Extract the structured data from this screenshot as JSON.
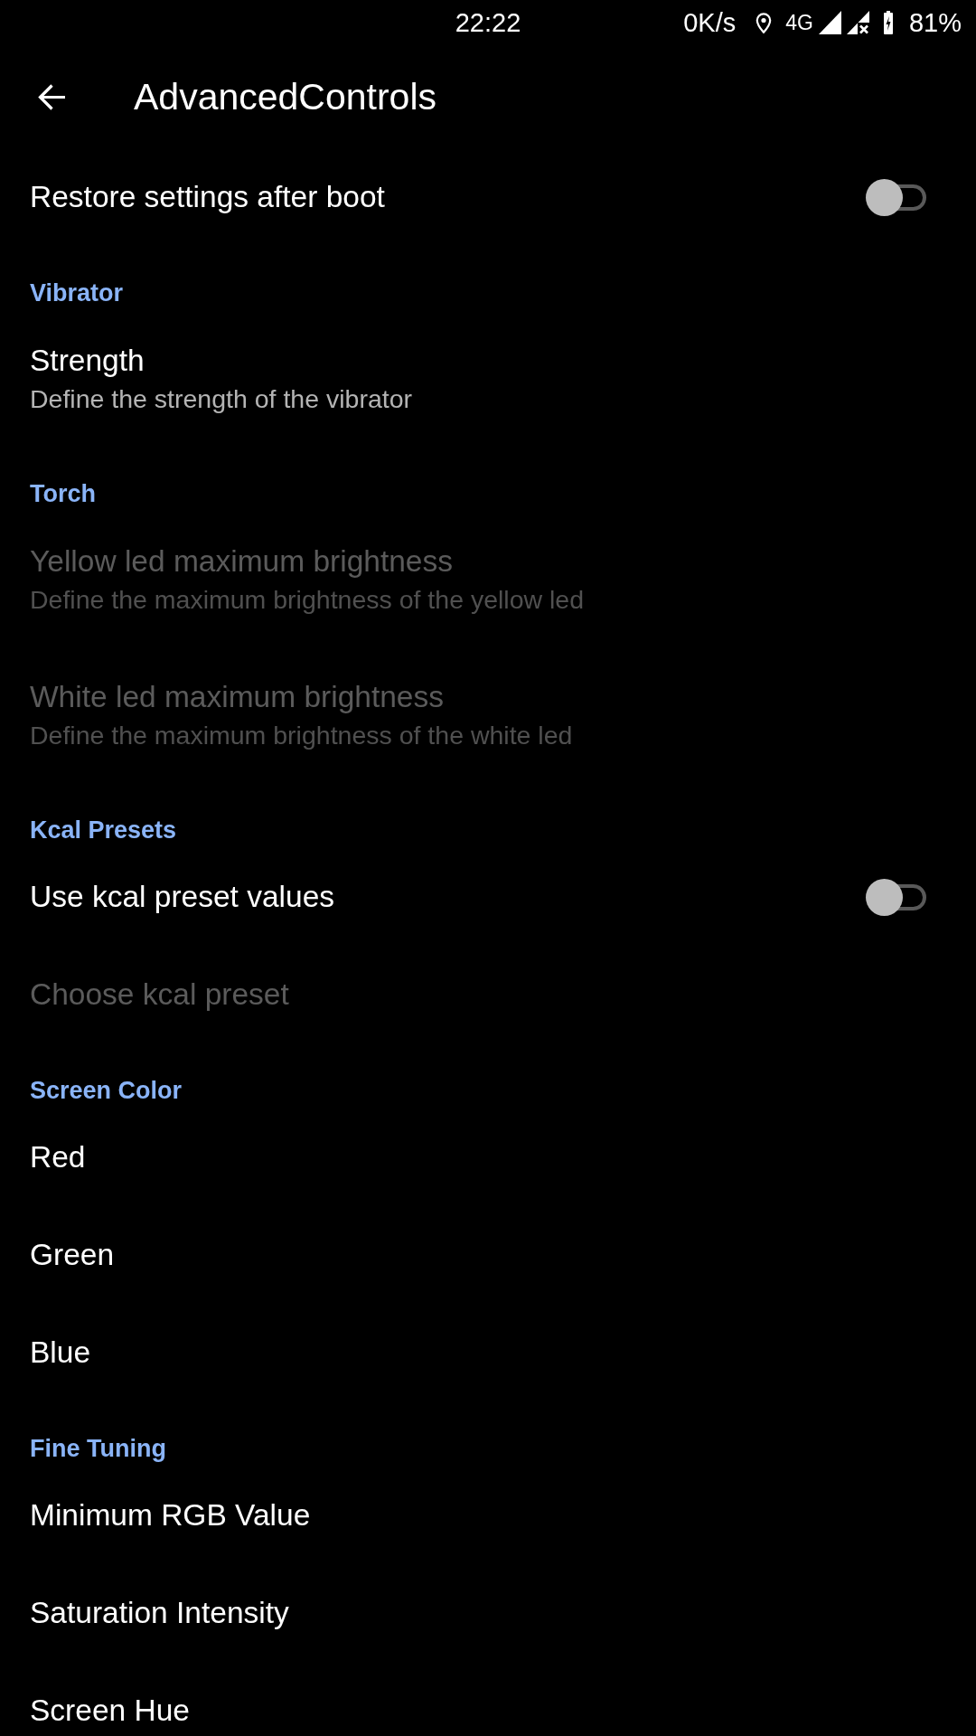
{
  "status_bar": {
    "time": "22:22",
    "network_speed": "0K/s",
    "network_type": "4G",
    "battery": "81%"
  },
  "toolbar": {
    "title": "AdvancedControls"
  },
  "sections": [
    {
      "items": [
        {
          "kind": "toggle",
          "title": "Restore settings after boot",
          "on": false,
          "disabled": false
        }
      ]
    },
    {
      "title": "Vibrator",
      "items": [
        {
          "kind": "text",
          "title": "Strength",
          "summary": "Define the strength of the vibrator",
          "disabled": false
        }
      ]
    },
    {
      "title": "Torch",
      "items": [
        {
          "kind": "text",
          "title": "Yellow led maximum brightness",
          "summary": "Define the maximum brightness of the yellow led",
          "disabled": true
        },
        {
          "kind": "text",
          "title": "White led maximum brightness",
          "summary": "Define the maximum brightness of the white led",
          "disabled": true
        }
      ]
    },
    {
      "title": "Kcal Presets",
      "items": [
        {
          "kind": "toggle",
          "title": "Use kcal preset values",
          "on": false,
          "disabled": false
        },
        {
          "kind": "text",
          "title": "Choose kcal preset",
          "disabled": true
        }
      ]
    },
    {
      "title": "Screen Color",
      "items": [
        {
          "kind": "text",
          "title": "Red",
          "disabled": false
        },
        {
          "kind": "text",
          "title": "Green",
          "disabled": false
        },
        {
          "kind": "text",
          "title": "Blue",
          "disabled": false
        }
      ]
    },
    {
      "title": "Fine Tuning",
      "items": [
        {
          "kind": "text",
          "title": "Minimum RGB Value",
          "disabled": false
        },
        {
          "kind": "text",
          "title": "Saturation Intensity",
          "disabled": false
        },
        {
          "kind": "text",
          "title": "Screen Hue",
          "disabled": false
        }
      ]
    }
  ]
}
